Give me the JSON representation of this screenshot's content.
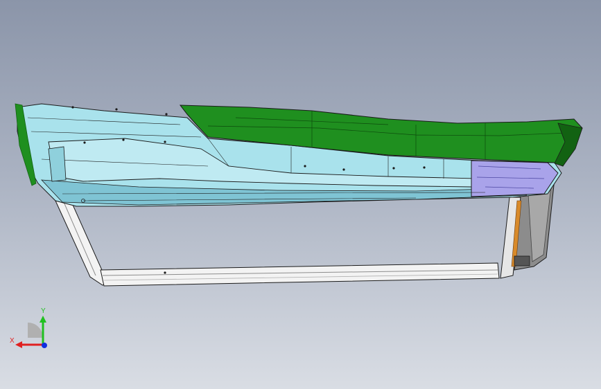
{
  "viewport": {
    "background_top": "#8b95a9",
    "background_bottom": "#d9dde4"
  },
  "model": {
    "colors": {
      "green_panel": "#1f8f1f",
      "green_panel_dark": "#126212",
      "cyan_trim": "#a9e2ec",
      "cyan_trim_shade": "#7fc4d4",
      "purple_section": "#a9a3ea",
      "frame_white": "#f3f3f3",
      "frame_gray": "#8c8c8c",
      "edge": "#1a1a1a",
      "orange_seal": "#d88a2a"
    }
  },
  "triad": {
    "x_label": "X",
    "y_label": "Y",
    "colors": {
      "x": "#e02020",
      "y": "#20c020",
      "z": "#1030e0",
      "sphere": "#b0b0b0"
    }
  }
}
